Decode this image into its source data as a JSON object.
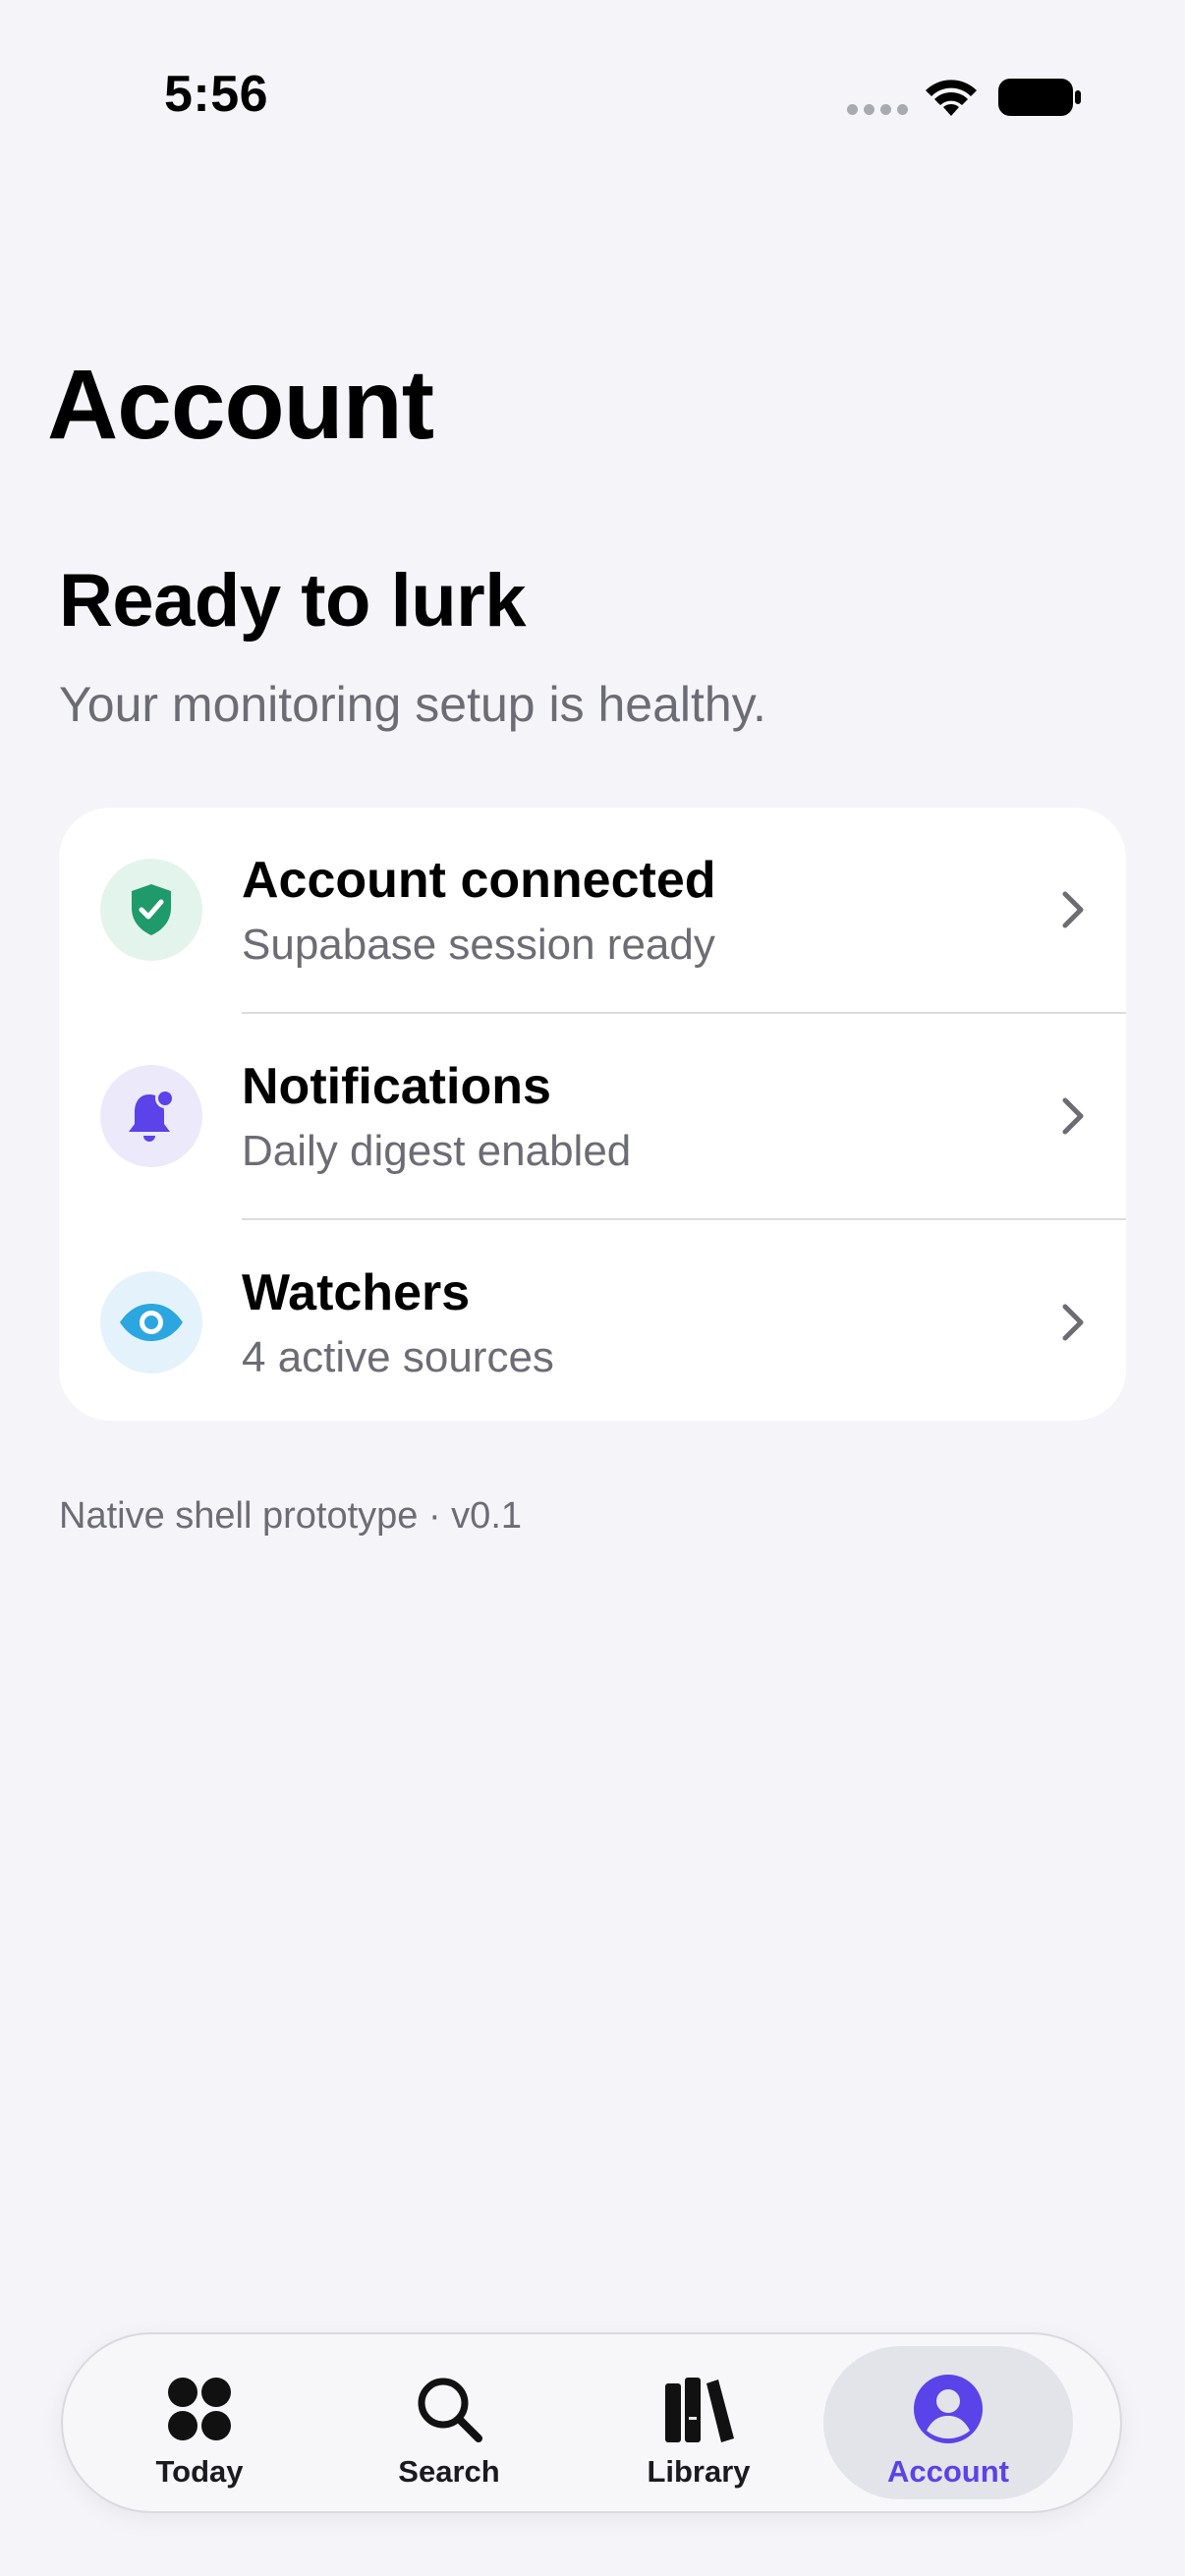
{
  "status_bar": {
    "time": "5:56"
  },
  "page": {
    "title": "Account"
  },
  "hero": {
    "title": "Ready to lurk",
    "subtitle": "Your monitoring setup is healthy."
  },
  "settings_rows": [
    {
      "title": "Account connected",
      "subtitle": "Supabase session ready",
      "icon": "shield-check-icon",
      "icon_color": "#1f9a6b",
      "icon_bg": "#e3f4ec"
    },
    {
      "title": "Notifications",
      "subtitle": "Daily digest enabled",
      "icon": "bell-badge-icon",
      "icon_color": "#5a43e8",
      "icon_bg": "#ece9fb"
    },
    {
      "title": "Watchers",
      "subtitle": "4 active sources",
      "icon": "eye-icon",
      "icon_color": "#2ba6e0",
      "icon_bg": "#e4f3fb"
    }
  ],
  "footer": {
    "note": "Native shell prototype · v0.1"
  },
  "tab_bar": {
    "tabs": [
      {
        "label": "Today",
        "icon": "grid-dots-icon",
        "active": false
      },
      {
        "label": "Search",
        "icon": "magnifier-icon",
        "active": false
      },
      {
        "label": "Library",
        "icon": "books-icon",
        "active": false
      },
      {
        "label": "Account",
        "icon": "person-circle-icon",
        "active": true
      }
    ],
    "accent_color": "#5a43e8"
  }
}
